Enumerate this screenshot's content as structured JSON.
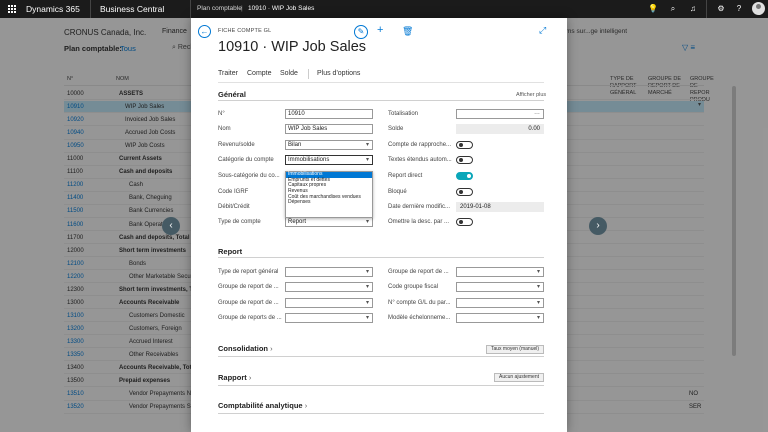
{
  "topbar": {
    "app_name": "Dynamics 365",
    "product": "Business Central",
    "breadcrumb": [
      "Plan comptable",
      "10910 · WIP Job Sales"
    ]
  },
  "background": {
    "company": "CRONUS Canada, Inc.",
    "section_tab": "Finance",
    "page_label": "Plan comptable:",
    "page_filter": "Tous",
    "search_label": "Recher",
    "suggestion_text": "ms sur...ge intelligent",
    "columns": {
      "no": "N°",
      "name": "NOM",
      "report_type": "TYPE DE RAPPORT GÉNÉRAL",
      "report_group": "GROUPE DE REPORT DE MARCHÉ",
      "report_group2": "GROUPE DE REPOR PRODU"
    },
    "rows": [
      {
        "no": "10000",
        "name": "ASSETS",
        "style": "bold",
        "right": ""
      },
      {
        "no": "10910",
        "name": "WIP Job Sales",
        "style": "i1",
        "right": "",
        "selected": true
      },
      {
        "no": "10920",
        "name": "Invoiced Job Sales",
        "style": "i1",
        "right": ""
      },
      {
        "no": "10940",
        "name": "Accrued Job Costs",
        "style": "i1",
        "right": ""
      },
      {
        "no": "10950",
        "name": "WIP Job Costs",
        "style": "i1",
        "right": ""
      },
      {
        "no": "11000",
        "name": "Current Assets",
        "style": "bold",
        "right": ""
      },
      {
        "no": "11100",
        "name": "Cash and deposits",
        "style": "bold",
        "right": ""
      },
      {
        "no": "11200",
        "name": "Cash",
        "style": "i2",
        "right": ""
      },
      {
        "no": "11400",
        "name": "Bank, Cheguing",
        "style": "i2",
        "right": ""
      },
      {
        "no": "11500",
        "name": "Bank Currencies",
        "style": "i2",
        "right": ""
      },
      {
        "no": "11600",
        "name": "Bank Operations",
        "style": "i2",
        "right": ""
      },
      {
        "no": "11700",
        "name": "Cash and deposits, Total",
        "style": "bold",
        "right": ""
      },
      {
        "no": "12000",
        "name": "Short term investments",
        "style": "bold",
        "right": ""
      },
      {
        "no": "12100",
        "name": "Bonds",
        "style": "i2",
        "right": ""
      },
      {
        "no": "12200",
        "name": "Other Marketable Securities",
        "style": "i2",
        "right": ""
      },
      {
        "no": "12300",
        "name": "Short term investments, Total",
        "style": "bold",
        "right": ""
      },
      {
        "no": "13000",
        "name": "Accounts Receivable",
        "style": "bold",
        "right": ""
      },
      {
        "no": "13100",
        "name": "Customers Domestic",
        "style": "i2",
        "right": ""
      },
      {
        "no": "13200",
        "name": "Customers, Foreign",
        "style": "i2",
        "right": ""
      },
      {
        "no": "13300",
        "name": "Accrued Interest",
        "style": "i2",
        "right": ""
      },
      {
        "no": "13350",
        "name": "Other Receivables",
        "style": "i2",
        "right": ""
      },
      {
        "no": "13400",
        "name": "Accounts Receivable, Total",
        "style": "bold",
        "right": ""
      },
      {
        "no": "13500",
        "name": "Prepaid expenses",
        "style": "bold",
        "right": ""
      },
      {
        "no": "13510",
        "name": "Vendor Prepayments NO",
        "style": "i2",
        "right": "NO"
      },
      {
        "no": "13520",
        "name": "Vendor Prepayments SER",
        "style": "i2",
        "right": "SER"
      }
    ]
  },
  "card": {
    "page_type": "FICHE COMPTE GL",
    "title": "10910 · WIP Job Sales",
    "actions": [
      "Traiter",
      "Compte",
      "Solde",
      "Plus d'options"
    ],
    "general": {
      "heading": "Général",
      "show_more": "Afficher plus",
      "no_label": "N°",
      "no_value": "10910",
      "name_label": "Nom",
      "name_value": "WIP Job Sales",
      "income_label": "Revenu/solde",
      "income_value": "Bilan",
      "category_label": "Catégorie du compte",
      "category_value": "Immobilisations",
      "subcategory_label": "Sous-catégorie du co...",
      "igrf_label": "Code IGRF",
      "debit_label": "Débit/Crédit",
      "account_type_label": "Type de compte",
      "account_type_value": "Report",
      "totaling_label": "Totalisation",
      "balance_label": "Solde",
      "balance_value": "0.00",
      "reconcile_label": "Compte de rapproche...",
      "extended_label": "Textes étendus autom...",
      "direct_label": "Report direct",
      "blocked_label": "Bloqué",
      "lastmod_label": "Date dernière modific...",
      "lastmod_value": "2019-01-08",
      "omit_label": "Omettre la desc. par ...",
      "category_options": [
        "Immobilisations",
        "Emprunts et dettes",
        "Capitaux propres",
        "Revenus",
        "Coût des marchandises vendues",
        "Dépenses"
      ]
    },
    "report": {
      "heading": "Report",
      "gen_type_label": "Type de report général",
      "bus_group_label": "Groupe de report de ...",
      "prod_group_label": "Groupe de report de ...",
      "vat_group_label": "Groupe de reports de ...",
      "bus_group2_label": "Groupe de report de ...",
      "tax_group_label": "Code groupe fiscal",
      "ic_label": "N° compte G/L du par...",
      "template_label": "Modèle échelonneme..."
    },
    "consolidation": {
      "heading": "Consolidation",
      "button": "Taux moyen (manuel)"
    },
    "rapport": {
      "heading": "Rapport",
      "button": "Aucun ajustement"
    },
    "analytics": {
      "heading": "Comptabilité analytique"
    }
  }
}
